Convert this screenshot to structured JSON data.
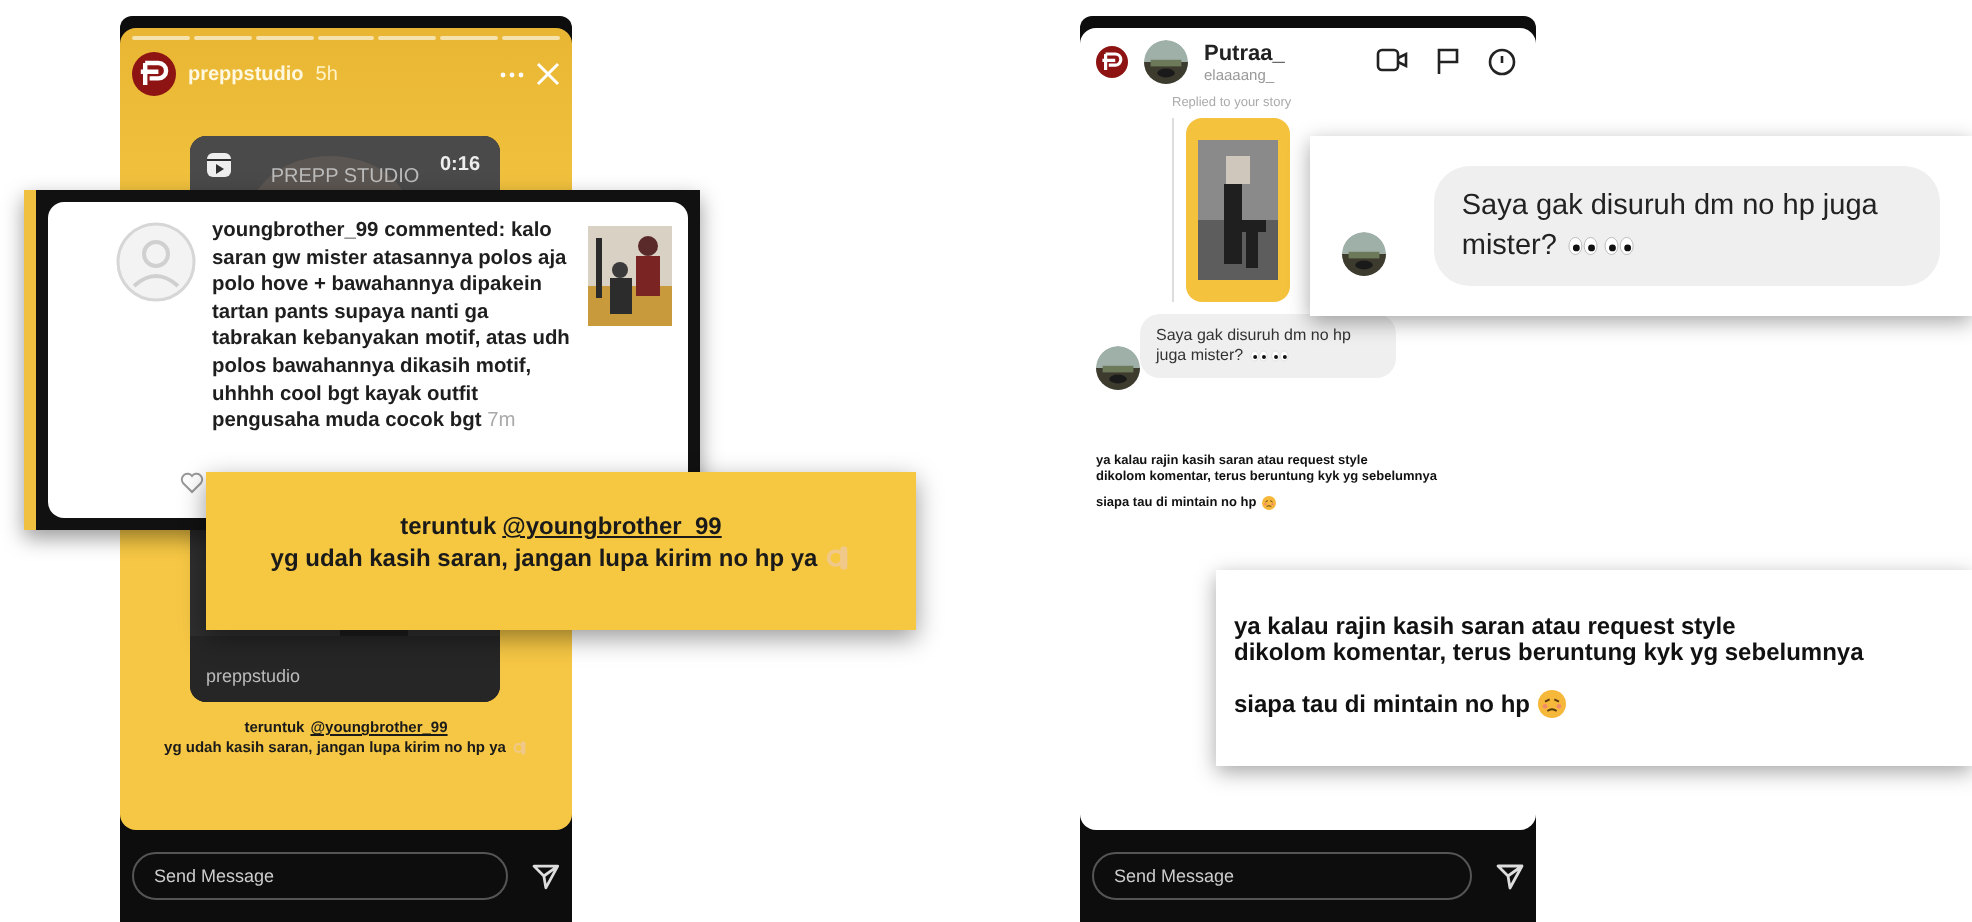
{
  "story_screen": {
    "account": "preppstudio",
    "time": "5h",
    "video_card": {
      "duration": "0:16",
      "title": "PREPP STUDIO",
      "account": "preppstudio"
    },
    "caption": {
      "prefix": "teruntuk",
      "mention": "@youngbrother_99",
      "line2": "yg udah kasih saran, jangan lupa kirim no hp ya"
    },
    "message_placeholder": "Send Message"
  },
  "comment_callout": {
    "username": "youngbrother_99",
    "action": "commented:",
    "text": "kalo saran gw mister atasannya polos aja polo hove + bawahannya dipakein tartan pants supaya nanti ga tabrakan kebanyakan motif, atas udh polos bawahannya dikasih motif, uhhhh cool bgt kayak outfit pengusaha muda cocok bgt",
    "time": "7m"
  },
  "caption_callout": {
    "prefix": "teruntuk",
    "mention": "@youngbrother_99",
    "line2": "yg udah kasih saran, jangan lupa kirim no hp ya"
  },
  "dm_screen": {
    "account_name": "Putraa_",
    "account_handle": "elaaaang_",
    "reply_label": "Replied to your story",
    "message": "Saya gak disuruh dm no hp juga mister?",
    "story_text": [
      "ya kalau rajin kasih saran atau request style",
      "dikolom komentar, terus beruntung kyk yg sebelumnya",
      "siapa tau di mintain no hp"
    ],
    "message_placeholder": "Send Message"
  },
  "message_callout": {
    "message": "Saya gak disuruh dm no hp juga mister?"
  },
  "text_callout": {
    "lines": [
      "ya kalau rajin kasih saran atau request style",
      "dikolom komentar, terus beruntung kyk yg sebelumnya",
      "siapa tau di mintain no hp"
    ]
  }
}
